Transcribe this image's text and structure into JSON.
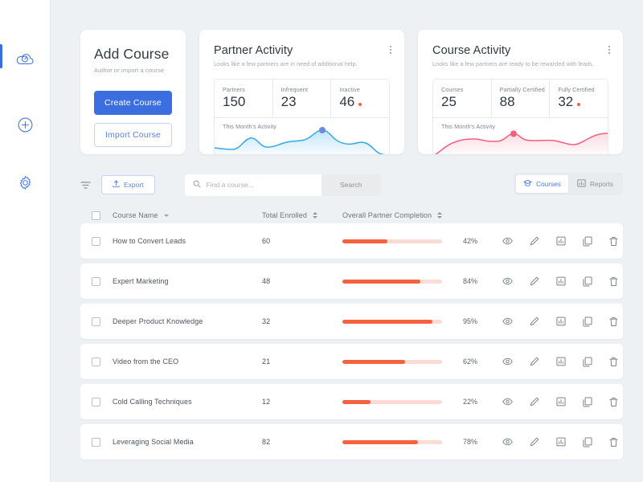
{
  "sidebar": {
    "items": [
      {
        "name": "dashboard",
        "icon": "cloud-speedometer-icon",
        "active": true
      },
      {
        "name": "add",
        "icon": "plus-circle-icon",
        "active": false
      },
      {
        "name": "settings",
        "icon": "gear-icon",
        "active": false
      }
    ]
  },
  "add_course": {
    "title": "Add Course",
    "subtitle": "Author or import a course",
    "create_label": "Create Course",
    "import_label": "Import Course",
    "primary_color": "#3b6fe0"
  },
  "partner_activity": {
    "title": "Partner Activity",
    "description": "Looks like a few partners are in need of additional help.",
    "menu_icon": "kebab-menu-icon",
    "stats": [
      {
        "label": "Partners",
        "value": "150",
        "dot": false
      },
      {
        "label": "Infrequent",
        "value": "23",
        "dot": false
      },
      {
        "label": "Inactive",
        "value": "46",
        "dot": true
      }
    ],
    "spark_label": "This Month's Activity",
    "line_color": "#35a8e8",
    "dot_color": "#6b8ae0"
  },
  "course_activity": {
    "title": "Course Activity",
    "description": "Looks like a few partners are ready to be rewarded with leads.",
    "menu_icon": "kebab-menu-icon",
    "stats": [
      {
        "label": "Courses",
        "value": "25",
        "dot": false
      },
      {
        "label": "Partially Certified",
        "value": "88",
        "dot": false
      },
      {
        "label": "Fully Certified",
        "value": "32",
        "dot": true
      }
    ],
    "spark_label": "This Month's Activity",
    "line_color": "#f2607e",
    "dot_color": "#f2607e"
  },
  "toolbar": {
    "filter_icon": "filter-icon",
    "export_label": "Export",
    "export_icon": "upload-icon",
    "search_placeholder": "Find a course...",
    "search_value": "",
    "search_button_label": "Search",
    "search_icon": "search-icon",
    "segments": [
      {
        "label": "Courses",
        "icon": "graduation-cap-icon",
        "active": true
      },
      {
        "label": "Reports",
        "icon": "bar-chart-icon",
        "active": false
      }
    ]
  },
  "table": {
    "headers": {
      "name": "Course Name",
      "enrolled": "Total Enrolled",
      "completion": "Overall Partner Completion"
    },
    "row_actions": [
      "view-icon",
      "edit-icon",
      "report-icon",
      "duplicate-icon",
      "delete-icon"
    ],
    "progress_track_color": "#fbdcd4",
    "progress_fill_color": "#f4623f",
    "rows": [
      {
        "name": "How to Convert Leads",
        "enrolled": "60",
        "percent": "42%",
        "bar": 45
      },
      {
        "name": "Expert Marketing",
        "enrolled": "48",
        "percent": "84%",
        "bar": 78
      },
      {
        "name": "Deeper Product Knowledge",
        "enrolled": "32",
        "percent": "95%",
        "bar": 90
      },
      {
        "name": "Video from the CEO",
        "enrolled": "21",
        "percent": "62%",
        "bar": 63
      },
      {
        "name": "Cold Calling Techniques",
        "enrolled": "12",
        "percent": "22%",
        "bar": 28
      },
      {
        "name": "Leveraging Social Media",
        "enrolled": "82",
        "percent": "78%",
        "bar": 76
      }
    ]
  },
  "chart_data": [
    {
      "type": "area",
      "title": "This Month's Activity",
      "series_name": "Partner Activity",
      "x": [
        0,
        1,
        2,
        3,
        4,
        5,
        6,
        7,
        8,
        9,
        10,
        11,
        12,
        13,
        14
      ],
      "values": [
        22,
        20,
        19,
        24,
        44,
        30,
        22,
        28,
        40,
        41,
        34,
        62,
        44,
        28,
        32
      ],
      "marker": {
        "x": 11,
        "y": 62
      },
      "ylim": [
        0,
        70
      ],
      "grid": false,
      "legend": "none",
      "line_color": "#35a8e8"
    },
    {
      "type": "area",
      "title": "This Month's Activity",
      "series_name": "Course Activity",
      "x": [
        0,
        1,
        2,
        3,
        4,
        5,
        6,
        7,
        8,
        9,
        10,
        11,
        12,
        13,
        14
      ],
      "values": [
        5,
        22,
        36,
        41,
        36,
        32,
        37,
        48,
        40,
        38,
        34,
        28,
        36,
        48,
        52
      ],
      "marker": {
        "x": 7,
        "y": 48
      },
      "ylim": [
        0,
        60
      ],
      "grid": false,
      "legend": "none",
      "line_color": "#f2607e"
    }
  ]
}
